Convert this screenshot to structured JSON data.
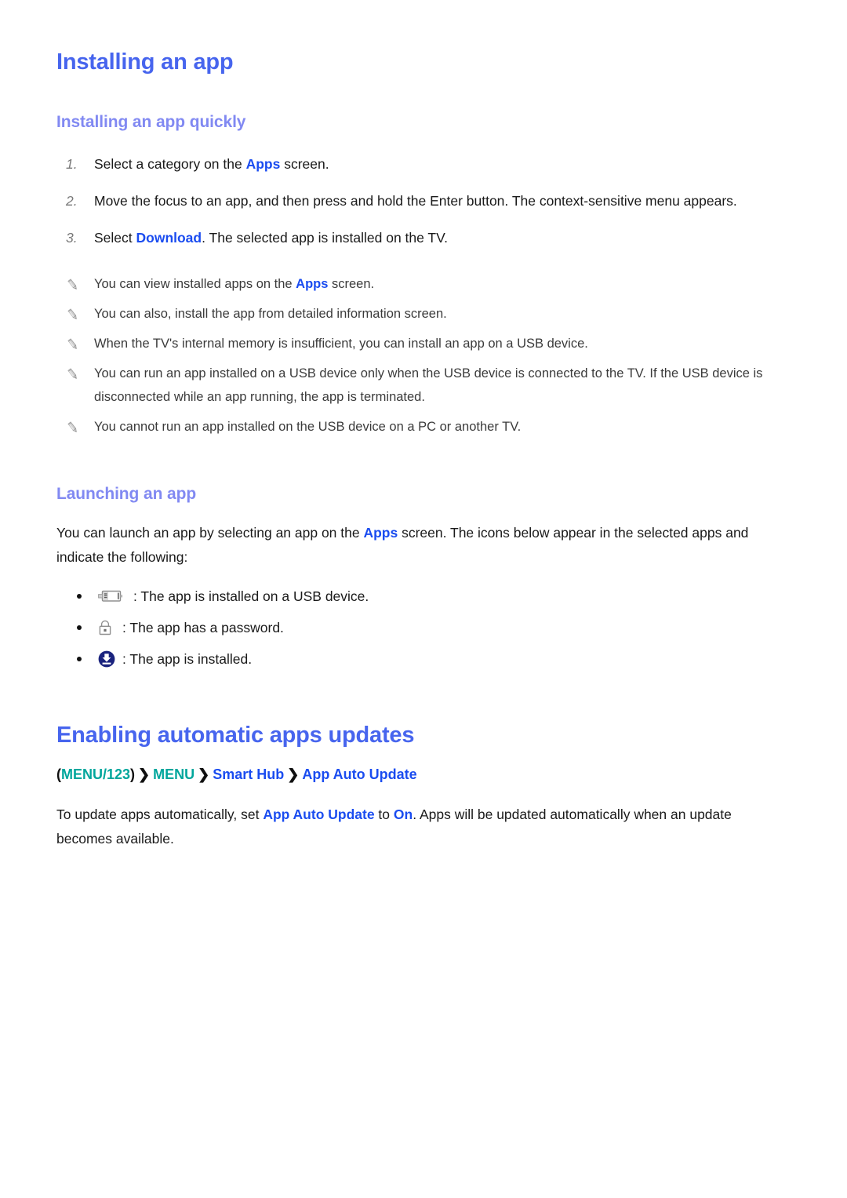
{
  "document": {
    "title": "Installing an app"
  },
  "section_install": {
    "heading": "Installing an app",
    "subheading": "Installing an app quickly",
    "steps": [
      {
        "number": "1.",
        "prefix": "Select a category on the ",
        "highlight": "Apps",
        "suffix": " screen."
      },
      {
        "number": "2.",
        "prefix": "Move the focus to an app, and then press and hold the Enter button. The context-sensitive menu appears.",
        "highlight": "",
        "suffix": ""
      },
      {
        "number": "3.",
        "prefix": "Select ",
        "highlight": "Download",
        "suffix": ". The selected app is installed on the TV."
      }
    ],
    "notes": [
      {
        "icon": "pencil-icon",
        "prefix": "You can view installed apps on the ",
        "highlight": "Apps",
        "suffix": " screen."
      },
      {
        "icon": "pencil-icon",
        "prefix": "You can also, install the app from detailed information screen.",
        "highlight": "",
        "suffix": ""
      },
      {
        "icon": "pencil-icon",
        "prefix": "When the TV's internal memory is insufficient, you can install an app on a USB device.",
        "highlight": "",
        "suffix": ""
      },
      {
        "icon": "pencil-icon",
        "prefix": "You can run an app installed on a USB device only when the USB device is connected to the TV. If the USB device is disconnected while an app running, the app is terminated.",
        "highlight": "",
        "suffix": ""
      },
      {
        "icon": "pencil-icon",
        "prefix": "You cannot run an app installed on the USB device on a PC or another TV.",
        "highlight": "",
        "suffix": ""
      }
    ]
  },
  "section_launch": {
    "subheading": "Launching an app",
    "intro_prefix": "You can launch an app by selecting an app on the ",
    "intro_highlight": "Apps",
    "intro_suffix": " screen. The icons below appear in the selected apps and indicate the following:",
    "icon_items": [
      {
        "icon": "usb-device-icon",
        "label": ": The app is installed on a USB device."
      },
      {
        "icon": "padlock-icon",
        "label": ": The app has a password."
      },
      {
        "icon": "download-circle-icon",
        "label": ": The app is installed."
      }
    ]
  },
  "section_update": {
    "heading": "Enabling automatic apps updates",
    "breadcrumb": {
      "open_paren": "(",
      "menu123": "MENU/123",
      "close_paren": ")",
      "chevron": "❯",
      "menu": "MENU",
      "smart_hub": "Smart Hub",
      "app_auto_update": "App Auto Update"
    },
    "body_prefix": "To update apps automatically, set ",
    "body_highlight_1": "App Auto Update",
    "body_middle": " to ",
    "body_highlight_2": "On",
    "body_suffix": ". Apps will be updated automatically when an update becomes available."
  },
  "colors": {
    "title_blue": "#4765ee",
    "subtitle_blue": "#8189f2",
    "link_blue": "#1a4cf0",
    "menu_teal": "#00a69c",
    "body_text": "#1a1a1a",
    "note_text": "#3b3b3b",
    "numeral_gray": "#7a7a7a",
    "download_icon_blue": "#1a237e",
    "icon_gray": "#9a9a9a"
  }
}
